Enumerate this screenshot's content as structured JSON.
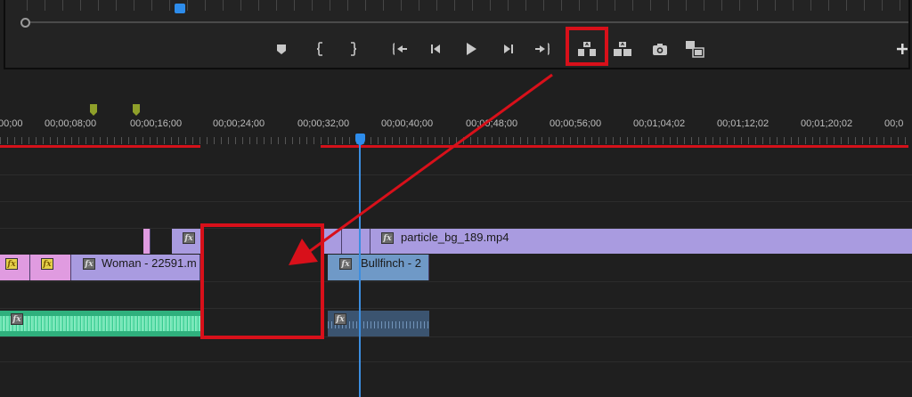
{
  "timecodes": [
    "00;00",
    "00;00;08;00",
    "00;00;16;00",
    "00;00;24;00",
    "00;00;32;00",
    "00;00;40;00",
    "00;00;48;00",
    "00;00;56;00",
    "00;01;04;02",
    "00;01;12;02",
    "00;01;20;02",
    "00;0"
  ],
  "clips": {
    "particle": "particle_bg_189.mp4",
    "woman": "Woman - 22591.m",
    "bullfinch": "Bullfinch - 2",
    "fx": "fx"
  },
  "icons": [
    "add-marker-icon",
    "mark-in-icon",
    "mark-out-icon",
    "go-to-in-icon",
    "step-back-icon",
    "play-icon",
    "step-forward-icon",
    "go-to-out-icon",
    "lift-icon",
    "extract-icon",
    "export-frame-icon",
    "compare-view-icon",
    "add-button-icon"
  ],
  "colors": {
    "accent": "#2d8ceb",
    "highlight": "#d8101a",
    "workarea": "#d4111a",
    "clip_violet": "#a99be0",
    "clip_pink": "#e09be0",
    "clip_blue": "#6f99c7",
    "audio_green": "#2fb07d"
  }
}
